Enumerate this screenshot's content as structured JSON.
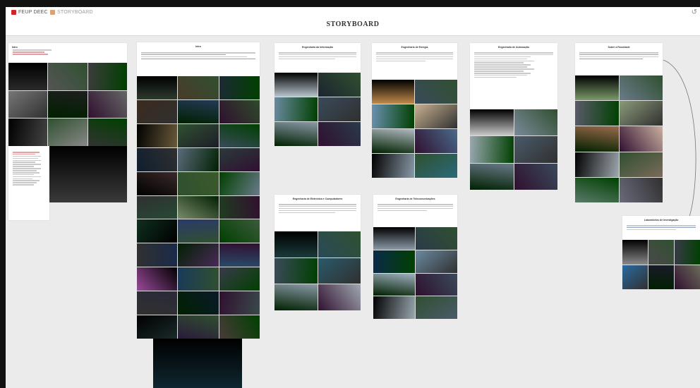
{
  "breadcrumb": {
    "workspace": "FEUP DEEC",
    "separator": "/",
    "board": "STORYBOARD",
    "workspace_color": "#d0262a",
    "board_color": "#e3a06a"
  },
  "board_title": "STORYBOARD",
  "icons": {
    "undo": "undo-icon"
  },
  "cards": {
    "c1": {
      "title": "Intro"
    },
    "c2": {
      "title": "Intro"
    },
    "c3": {
      "title": "Engenharia da Informação"
    },
    "c4": {
      "title": "Engenharia de Energia"
    },
    "c5": {
      "title": "Engenharia de Automação"
    },
    "c6": {
      "title": "Sobre a Faculdade"
    },
    "c7": {
      "title": "Engenharia de Eletrónica e Computadores"
    },
    "c8": {
      "title": "Engenharia de Telecomunicações"
    },
    "c9": {
      "title": "Laboratórios de Investigação"
    }
  }
}
